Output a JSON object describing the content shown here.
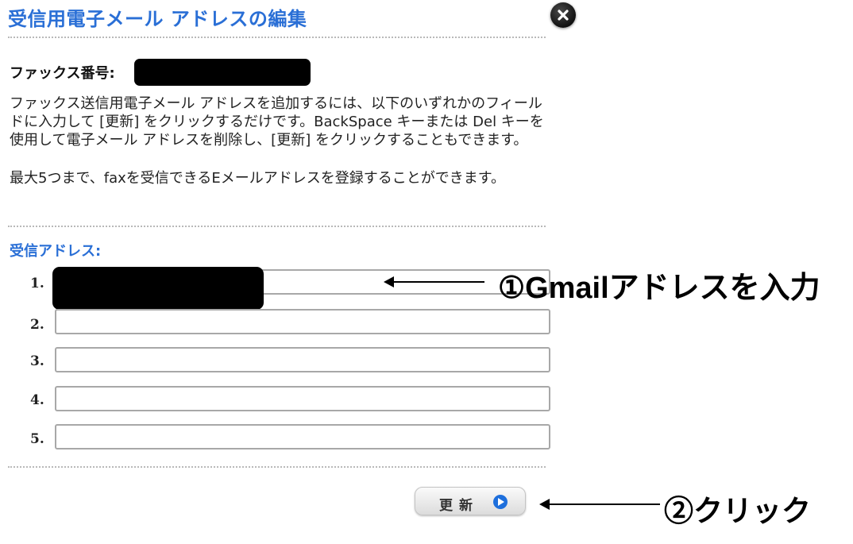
{
  "dialog": {
    "title": "受信用電子メール アドレスの編集"
  },
  "fax": {
    "label": "ファックス番号:",
    "value_redacted": true
  },
  "description": {
    "paragraph1": "ファックス送信用電子メール アドレスを追加するには、以下のいずれかのフィールドに入力して [更新] をクリックするだけです。BackSpace キーまたは Del キーを使用して電子メール アドレスを削除し、[更新] をクリックすることもできます。",
    "paragraph2": "最大5つまで、faxを受信できるEメールアドレスを登録することができます。"
  },
  "receive": {
    "section_title": "受信アドレス:",
    "addresses": [
      {
        "number": "1.",
        "value": "",
        "redacted": true
      },
      {
        "number": "2.",
        "value": ""
      },
      {
        "number": "3.",
        "value": ""
      },
      {
        "number": "4.",
        "value": ""
      },
      {
        "number": "5.",
        "value": ""
      }
    ]
  },
  "update_button": {
    "label": "更新"
  },
  "annotations": {
    "step1": "①Gmailアドレスを入力",
    "step2": "②クリック"
  },
  "colors": {
    "title_blue": "#2a6fd6",
    "button_icon_blue": "#1e6fdc",
    "redaction": "#000000"
  },
  "icons": {
    "close": "close-icon",
    "update": "play-circle-icon"
  }
}
